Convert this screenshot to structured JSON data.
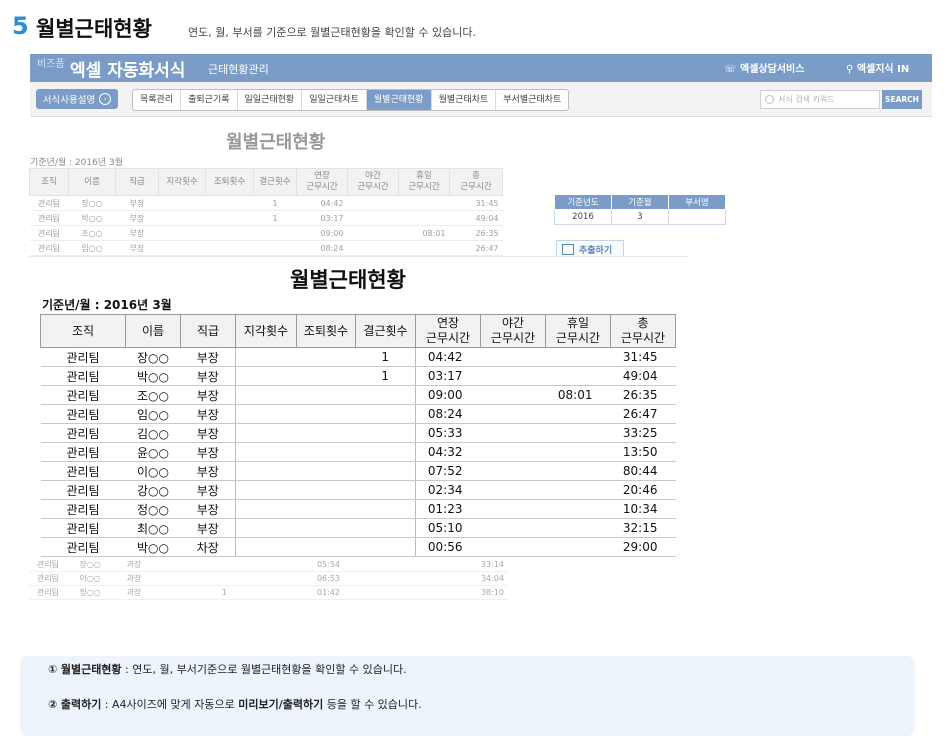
{
  "heading": {
    "step": "5",
    "title": "월별근태현황",
    "subtitle": "연도, 월, 부서를 기준으로 월별근태현황을 확인할 수 있습니다."
  },
  "app_bar": {
    "brand_small": "비즈폼",
    "brand_title": "엑셀 자동화서식",
    "brand_sub": "근태현황관리",
    "service_link": "엑셀상담서비스",
    "kin_link": "엑셀지식 IN",
    "accent_color": "#7a9cc6"
  },
  "nav_bar": {
    "guide_button": "서식사용설명",
    "tabs": [
      "목록관리",
      "출퇴근기록",
      "일일근태현황",
      "일일근태차트",
      "월별근태현황",
      "월별근태차트",
      "부서별근태차트"
    ],
    "active_tab": "월별근태현황",
    "search_placeholder": "서식 검색 키워드",
    "search_button": "SEARCH"
  },
  "background_report": {
    "title": "월별근태현황",
    "period": "기준년/월 : 2016년 3월",
    "headers": [
      "조직",
      "이름",
      "직급",
      "지각횟수",
      "조퇴횟수",
      "결근횟수",
      "연장\n근무시간",
      "야간\n근무시간",
      "휴일\n근무시간",
      "총\n근무시간"
    ],
    "rows": [
      [
        "관리팀",
        "장○○",
        "부장",
        "",
        "",
        "1",
        "04:42",
        "",
        "",
        "31:45"
      ],
      [
        "관리팀",
        "박○○",
        "부장",
        "",
        "",
        "1",
        "03:17",
        "",
        "",
        "49:04"
      ],
      [
        "관리팀",
        "조○○",
        "부장",
        "",
        "",
        "",
        "09:00",
        "",
        "08:01",
        "26:35"
      ],
      [
        "관리팀",
        "임○○",
        "부장",
        "",
        "",
        "",
        "08:24",
        "",
        "",
        "26:47"
      ]
    ],
    "tail_rows": [
      [
        "관리팀",
        "장○○",
        "과장",
        "",
        "",
        "",
        "05:54",
        "",
        "",
        "33:14"
      ],
      [
        "관리팀",
        "이○○",
        "과장",
        "",
        "",
        "",
        "06:53",
        "",
        "",
        "34:04"
      ],
      [
        "관리팀",
        "정○○",
        "과장",
        "",
        "1",
        "",
        "01:42",
        "",
        "",
        "38:10"
      ]
    ]
  },
  "filter": {
    "headers": [
      "기준년도",
      "기준월",
      "부서명"
    ],
    "values": [
      "2016",
      "3",
      ""
    ],
    "export_button": "추출하기"
  },
  "zoom_report": {
    "title": "월별근태현황",
    "period": "기준년/월 : 2016년 3월",
    "headers": [
      "조직",
      "이름",
      "직급",
      "지각횟수",
      "조퇴횟수",
      "결근횟수",
      "연장\n근무시간",
      "야간\n근무시간",
      "휴일\n근무시간",
      "총\n근무시간"
    ],
    "rows": [
      [
        "관리팀",
        "장○○",
        "부장",
        "",
        "",
        "1",
        "04:42",
        "",
        "",
        "31:45"
      ],
      [
        "관리팀",
        "박○○",
        "부장",
        "",
        "",
        "1",
        "03:17",
        "",
        "",
        "49:04"
      ],
      [
        "관리팀",
        "조○○",
        "부장",
        "",
        "",
        "",
        "09:00",
        "",
        "08:01",
        "26:35"
      ],
      [
        "관리팀",
        "임○○",
        "부장",
        "",
        "",
        "",
        "08:24",
        "",
        "",
        "26:47"
      ],
      [
        "관리팀",
        "김○○",
        "부장",
        "",
        "",
        "",
        "05:33",
        "",
        "",
        "33:25"
      ],
      [
        "관리팀",
        "윤○○",
        "부장",
        "",
        "",
        "",
        "04:32",
        "",
        "",
        "13:50"
      ],
      [
        "관리팀",
        "이○○",
        "부장",
        "",
        "",
        "",
        "07:52",
        "",
        "",
        "80:44"
      ],
      [
        "관리팀",
        "강○○",
        "부장",
        "",
        "",
        "",
        "02:34",
        "",
        "",
        "20:46"
      ],
      [
        "관리팀",
        "정○○",
        "부장",
        "",
        "",
        "",
        "01:23",
        "",
        "",
        "10:34"
      ],
      [
        "관리팀",
        "최○○",
        "부장",
        "",
        "",
        "",
        "05:10",
        "",
        "",
        "32:15"
      ],
      [
        "관리팀",
        "박○○",
        "차장",
        "",
        "",
        "",
        "00:56",
        "",
        "",
        "29:00"
      ]
    ]
  },
  "info": {
    "item1_num": "①",
    "item1_title": "월별근태현황",
    "item1_text": " : 연도, 월, 부서기준으로 월별근태현황을 확인할 수 있습니다.",
    "item2_num": "②",
    "item2_title": "출력하기",
    "item2_text_a": " : A4사이즈에 맞게 자동으로 ",
    "item2_bold": "미리보기/출력하기",
    "item2_text_b": " 등을 할 수 있습니다."
  }
}
